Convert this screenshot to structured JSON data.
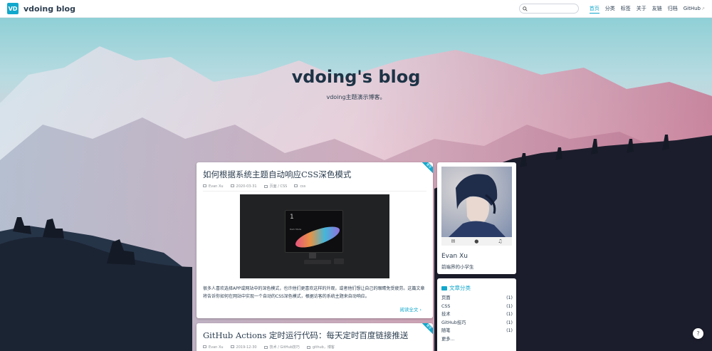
{
  "navbar": {
    "logo_text": "VD",
    "site_name": "vdoing blog",
    "search_placeholder": "",
    "links": [
      {
        "label": "首页",
        "active": true
      },
      {
        "label": "分类"
      },
      {
        "label": "标签"
      },
      {
        "label": "关于"
      },
      {
        "label": "友链"
      },
      {
        "label": "归档"
      },
      {
        "label": "GitHub",
        "external": true
      }
    ]
  },
  "banner": {
    "title": "vdoing's blog",
    "description": "vdoing主题演示博客。"
  },
  "posts": [
    {
      "title": "如何根据系统主题自动响应CSS深色模式",
      "author": "Evan Xu",
      "date": "2020-03-31",
      "categories": "页面 / CSS",
      "tags": "css",
      "sticky_label": "置顶",
      "image_number": "1",
      "image_text": "Dark Mode",
      "excerpt": "很多人喜欢选择APP或网站中的深色模式，也许他们更喜欢这样的外观，或者他们想让自己的眼睛免受疲劳。这篇文章将告诉你如何在网站中实现一个自动的CSS深色模式，根据访客的系统主题来自动响应。",
      "read_more": "阅读全文"
    },
    {
      "title": "GitHub Actions 定时运行代码：每天定时百度链接推送",
      "author": "Evan Xu",
      "date": "2019-12-30",
      "categories": "技术 / GitHub技巧",
      "tags": "github，博客",
      "sticky_label": "置顶"
    }
  ],
  "profile": {
    "name": "Evan Xu",
    "slogan": "前端界的小学生",
    "social_icons": [
      "mail-icon",
      "github-icon",
      "music-icon"
    ]
  },
  "categories": {
    "title": "文章分类",
    "items": [
      {
        "label": "页面",
        "count": "(1)"
      },
      {
        "label": "CSS",
        "count": "(1)"
      },
      {
        "label": "技术",
        "count": "(1)"
      },
      {
        "label": "GitHub技巧",
        "count": "(1)"
      },
      {
        "label": "随笔",
        "count": "(1)"
      }
    ],
    "more": "更多..."
  },
  "colors": {
    "accent": "#11a8cd",
    "text": "#2c3e50"
  }
}
